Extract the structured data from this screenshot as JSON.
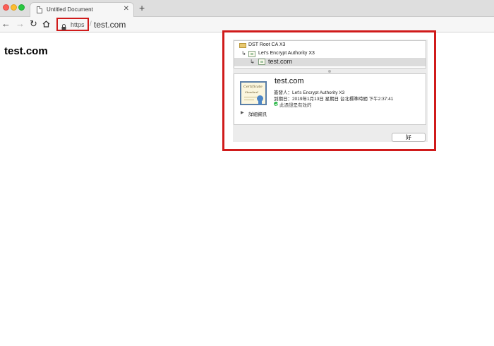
{
  "browser": {
    "tab": {
      "title": "Untitled Document",
      "close_glyph": "✕"
    },
    "new_tab_glyph": "+",
    "nav": {
      "back_glyph": "←",
      "forward_glyph": "→",
      "reload_glyph": "↻"
    },
    "address": {
      "scheme": "https",
      "separator": "/",
      "host": "test.com"
    }
  },
  "page": {
    "heading": "test.com"
  },
  "certificate_dialog": {
    "chain": [
      {
        "label": "DST Root CA X3",
        "icon": "folder-icon"
      },
      {
        "label": "Let's Encrypt Authority X3",
        "icon": "certificate-icon"
      },
      {
        "label": "test.com",
        "icon": "certificate-icon"
      }
    ],
    "chain_arrow_glyph": "↳",
    "detail": {
      "title": "test.com",
      "issuer": "簽發人：Let's Encrypt Authority X3",
      "expires": "到期日：2019年1月13日 星期日 台北標準時間 下午2:37:41",
      "valid": "此憑證是有效的",
      "details_toggle_glyph": "▶",
      "details_label": "詳細資訊",
      "cert_script_1": "Certificate",
      "cert_script_2": "Standard"
    },
    "ok_button": "好"
  },
  "colors": {
    "highlight": "#d01b1b",
    "valid_green": "#2db84a",
    "cert_blue": "#5a7fa8"
  }
}
